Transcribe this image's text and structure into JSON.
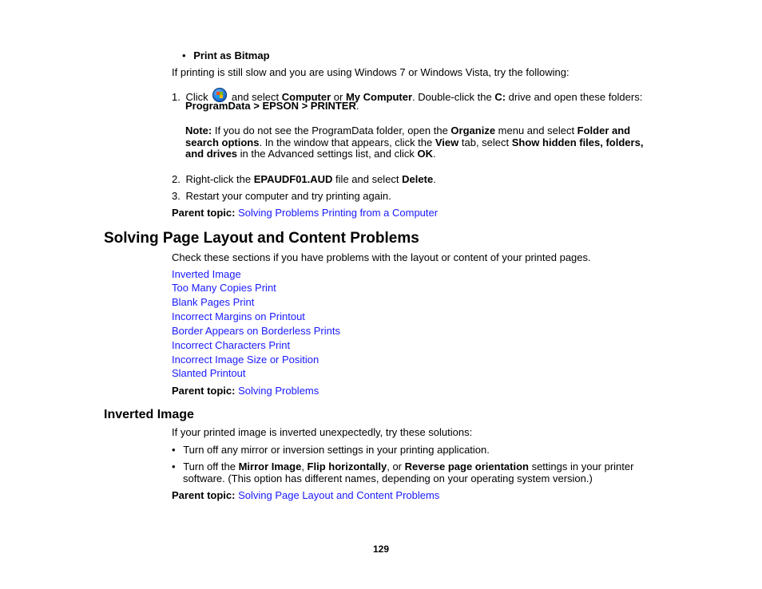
{
  "top_bullet": "Print as Bitmap",
  "intro": "If printing is still slow and you are using Windows 7 or Windows Vista, try the following:",
  "steps": {
    "step1": {
      "num": "1.",
      "t1": "Click ",
      "icon": "windows-start-icon",
      "t2": " and select ",
      "b1": "Computer",
      "t3": " or ",
      "b2": "My Computer",
      "t4": ". Double-click the ",
      "b3": "C:",
      "t5": " drive and open these folders:",
      "b4": "ProgramData > EPSON > PRINTER",
      "t6": "."
    },
    "note": {
      "label": "Note:",
      "t1": " If you do not see the ProgramData folder, open the ",
      "b1": "Organize",
      "t2": " menu and select ",
      "b2": "Folder and",
      "b3": "search options",
      "t3": ". In the window that appears, click the ",
      "b4": "View",
      "t4": " tab, select ",
      "b5": "Show hidden files, folders,",
      "b6": "and drives",
      "t5": " in the Advanced settings list, and click ",
      "b7": "OK",
      "t6": "."
    },
    "step2": {
      "num": "2.",
      "t1": "Right-click the ",
      "b1": "EPAUDF01.AUD",
      "t2": " file and select ",
      "b2": "Delete",
      "t3": "."
    },
    "step3": {
      "num": "3.",
      "t1": "Restart your computer and try printing again."
    }
  },
  "parent1": {
    "label": "Parent topic:",
    "link": "Solving Problems Printing from a Computer"
  },
  "section": {
    "title": "Solving Page Layout and Content Problems",
    "intro": "Check these sections if you have problems with the layout or content of your printed pages.",
    "links": [
      "Inverted Image",
      "Too Many Copies Print",
      "Blank Pages Print",
      "Incorrect Margins on Printout",
      "Border Appears on Borderless Prints",
      "Incorrect Characters Print",
      "Incorrect Image Size or Position",
      "Slanted Printout"
    ],
    "parent": {
      "label": "Parent topic:",
      "link": "Solving Problems"
    }
  },
  "inverted": {
    "title": "Inverted Image",
    "intro": "If your printed image is inverted unexpectedly, try these solutions:",
    "bullet1": "Turn off any mirror or inversion settings in your printing application.",
    "bullet2": {
      "t1": "Turn off the ",
      "b1": "Mirror Image",
      "t2": ", ",
      "b2": "Flip horizontally",
      "t3": ", or ",
      "b3": "Reverse page orientation",
      "t4": " settings in your printer",
      "line2": "software. (This option has different names, depending on your operating system version.)"
    },
    "parent": {
      "label": "Parent topic:",
      "link": "Solving Page Layout and Content Problems"
    }
  },
  "page_number": "129",
  "colors": {
    "link": "#1a1aff",
    "text": "#000000"
  }
}
